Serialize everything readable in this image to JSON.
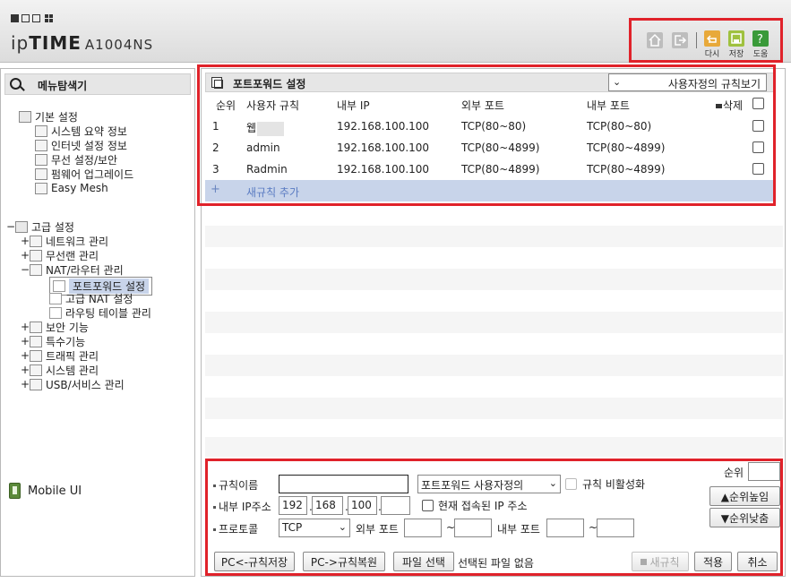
{
  "header": {
    "logo_ip": "ip",
    "logo_time": "TIME",
    "logo_model": "A1004NS",
    "buttons": [
      {
        "name": "home",
        "label": ""
      },
      {
        "name": "logout",
        "label": ""
      },
      {
        "name": "refresh",
        "label": "다시"
      },
      {
        "name": "save",
        "label": "저장"
      },
      {
        "name": "help",
        "label": "도움"
      }
    ]
  },
  "sidebar": {
    "title": "메뉴탐색기",
    "basic": {
      "label": "기본 설정",
      "items": [
        "시스템 요약 정보",
        "인터넷 설정 정보",
        "무선 설정/보안",
        "펌웨어 업그레이드",
        "Easy Mesh"
      ]
    },
    "advanced": {
      "label": "고급 설정",
      "items": [
        {
          "pm": "+",
          "label": "네트워크 관리"
        },
        {
          "pm": "+",
          "label": "무선랜 관리"
        },
        {
          "pm": "−",
          "label": "NAT/라우터 관리"
        },
        {
          "pm": "+",
          "label": "보안 기능"
        },
        {
          "pm": "+",
          "label": "특수기능"
        },
        {
          "pm": "+",
          "label": "트래픽 관리"
        },
        {
          "pm": "+",
          "label": "시스템 관리"
        },
        {
          "pm": "+",
          "label": "USB/서비스 관리"
        }
      ],
      "nat_children": [
        "포트포워드 설정",
        "고급 NAT 설정",
        "라우팅 테이블 관리"
      ]
    },
    "mobile_ui": "Mobile UI"
  },
  "main": {
    "title": "포트포워드 설정",
    "view_select": "사용자정의 규칙보기",
    "columns": {
      "order": "순위",
      "rule": "사용자 규칙",
      "internal_ip": "내부 IP",
      "external_port": "외부 포트",
      "internal_port": "내부 포트",
      "delete": "삭제"
    },
    "rows": [
      {
        "order": "1",
        "rule": "웹",
        "internal_ip": "192.168.100.100",
        "external_port": "TCP(80~80)",
        "internal_port": "TCP(80~80)"
      },
      {
        "order": "2",
        "rule": "admin",
        "internal_ip": "192.168.100.100",
        "external_port": "TCP(80~4899)",
        "internal_port": "TCP(80~4899)"
      },
      {
        "order": "3",
        "rule": "Radmin",
        "internal_ip": "192.168.100.100",
        "external_port": "TCP(80~4899)",
        "internal_port": "TCP(80~4899)"
      }
    ],
    "new_rule": "새규칙 추가"
  },
  "form": {
    "rule_name_label": "규칙이름",
    "rule_name_value": "",
    "rule_type": "포트포워드 사용자정의",
    "disable_label": "규칙 비활성화",
    "internal_ip_label": "내부 IP주소",
    "ip": [
      "192",
      "168",
      "100",
      ""
    ],
    "current_ip_label": "현재 접속된 IP 주소",
    "protocol_label": "프로토콜",
    "protocol": "TCP",
    "external_port_label": "외부 포트",
    "internal_port_label": "내부 포트",
    "tilde": "~",
    "order_label": "순위",
    "order_value": "",
    "order_up": "▲순위높임",
    "order_down": "▼순위낮춤",
    "save_pc": "PC<-규칙저장",
    "restore_pc": "PC->규칙복원",
    "file_select": "파일 선택",
    "no_file": "선택된 파일 없음",
    "new_rule_btn": "새규칙",
    "apply": "적용",
    "cancel": "취소"
  },
  "colors": {
    "highlight": "#e0222a",
    "selection": "#c8d4ea",
    "accent": "#5a7bc2"
  }
}
